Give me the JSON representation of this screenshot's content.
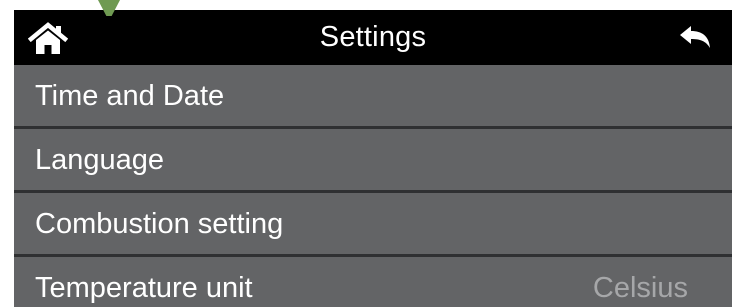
{
  "header": {
    "title": "Settings",
    "home_icon": "home-icon",
    "back_icon": "back-arrow-icon"
  },
  "menu": {
    "items": [
      {
        "label": "Time and Date",
        "value": ""
      },
      {
        "label": "Language",
        "value": ""
      },
      {
        "label": "Combustion setting",
        "value": ""
      },
      {
        "label": "Temperature unit",
        "value": "Celsius"
      }
    ]
  },
  "colors": {
    "header_bg": "#000000",
    "screen_bg": "#636466",
    "separator": "#2f3032",
    "text": "#ffffff",
    "value_text": "#a6a7a9",
    "accent_tab": "#6f9a52"
  }
}
